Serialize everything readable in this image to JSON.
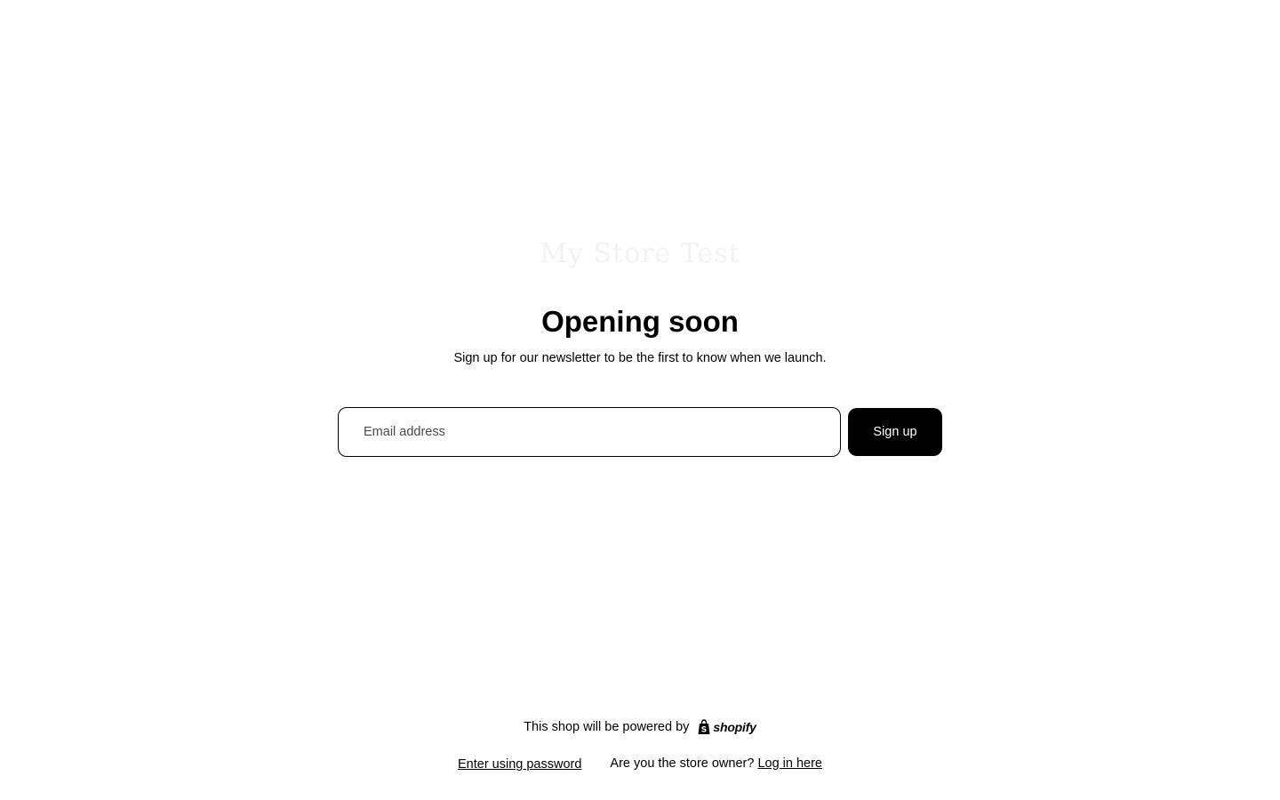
{
  "store": {
    "logo_text": "My Store Test"
  },
  "main": {
    "heading": "Opening soon",
    "subheading": "Sign up for our newsletter to be the first to know when we launch."
  },
  "signup": {
    "email_placeholder": "Email address",
    "email_value": "",
    "button_label": "Sign up"
  },
  "footer": {
    "powered_by_text": "This shop will be powered by",
    "shopify_label": "shopify",
    "shopify_icon": "shopify-bag-icon",
    "password_link": "Enter using password",
    "owner_question": "Are you the store owner?",
    "login_link": "Log in here"
  },
  "colors": {
    "background": "#ffffff",
    "text": "#000000",
    "button_bg": "#000000",
    "button_text": "#ffffff",
    "logo_faded": "#f2f2f2"
  }
}
